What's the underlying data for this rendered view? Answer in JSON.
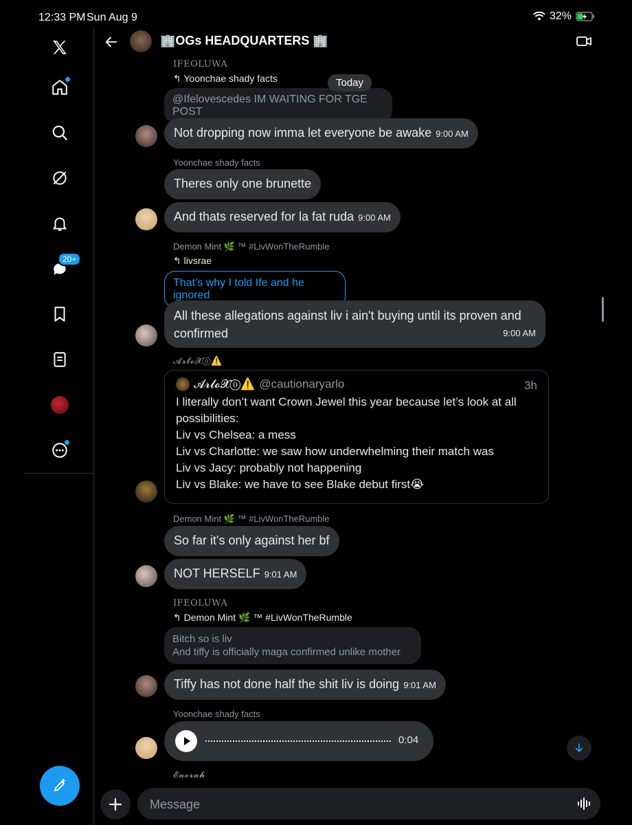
{
  "status": {
    "time": "12:33 PM",
    "date": "Sun Aug 9",
    "battery": "32%"
  },
  "header": {
    "title": "🏢OGs HEADQUARTERS 🏢",
    "back_icon": "arrow-left-icon",
    "video_icon": "video-icon"
  },
  "sidebar": {
    "dm_badge": "20+",
    "accent": "#1d9bf0"
  },
  "chat": {
    "today": "Today",
    "m1": {
      "name": "IFEOLUWA",
      "reply_to": "↰ Yoonchae shady facts",
      "quoted": "@Ifelovescedes IM WAITING FOR TGE POST"
    },
    "m2": {
      "text": "Not dropping now imma let everyone be awake",
      "time": "9:00 AM"
    },
    "m3": {
      "name": "Yoonchae shady facts",
      "text": "Theres only one brunette"
    },
    "m4": {
      "text": "And thats reserved for la fat ruda",
      "time": "9:00 AM"
    },
    "m5": {
      "name": "Demon Mint 🌿 ™ #LivWonTheRumble",
      "reply_to": "↰ livsrae",
      "quoted": "That’s why I told Ife and he ignored"
    },
    "m6": {
      "line1": "All these allegations against liv i ain't buying until its proven and",
      "line2": "confirmed",
      "time": "9:00 AM"
    },
    "m7": {
      "name": "𝓐𝓻𝓵𝓸𝓧⓪⚠️",
      "tweet_name": "𝓐𝓻𝓵𝓸𝓧⓪⚠️",
      "tweet_handle": "@cautionaryarlo",
      "tweet_age": "3h",
      "lines": [
        "I literally don’t want Crown Jewel this year because let’s look at all",
        "possibilities:",
        "Liv vs Chelsea: a mess",
        "Liv vs Charlotte: we saw how underwhelming their match was",
        "Liv vs Jacy: probably not happening",
        "Liv vs Blake: we have to see Blake debut first😭"
      ]
    },
    "m8": {
      "name": "Demon Mint 🌿 ™ #LivWonTheRumble",
      "text": "So far it's only against her bf"
    },
    "m9": {
      "text": "NOT HERSELF",
      "time": "9:01 AM"
    },
    "m10": {
      "name": "IFEOLUWA",
      "reply_to": "↰ Demon Mint 🌿 ™ #LivWonTheRumble",
      "quoted1": "Bitch so is liv",
      "quoted2": "And tiffy is officially maga confirmed unlike mother"
    },
    "m11": {
      "text": "Tiffy has not done half the shit liv is doing",
      "time": "9:01 AM"
    },
    "m12": {
      "name": "Yoonchae shady facts",
      "duration": "0:04"
    },
    "m13": {
      "name": "𝓔𝓷𝓸𝓻𝓪𝓱"
    }
  },
  "composer": {
    "placeholder": "Message"
  }
}
